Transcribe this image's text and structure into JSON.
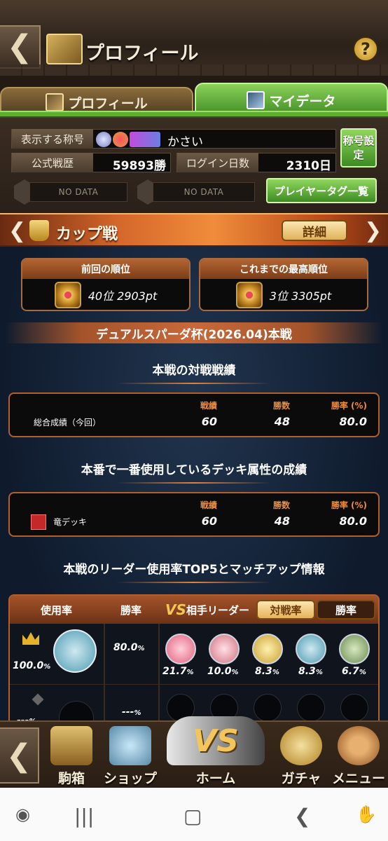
{
  "header": {
    "title": "プロフィール"
  },
  "tabs": [
    {
      "label": "プロフィール",
      "active": false
    },
    {
      "label": "マイデータ",
      "active": true
    }
  ],
  "profile": {
    "title_label": "表示する称号",
    "title_value": "かさい",
    "title_settings_button": "称号設定",
    "official_record_label": "公式戦歴",
    "official_record_value": "59893勝",
    "login_days_label": "ログイン日数",
    "login_days_value": "2310日",
    "no_data_1": "NO DATA",
    "no_data_2": "NO DATA",
    "player_tag_button": "プレイヤータグ一覧"
  },
  "cup": {
    "title": "カップ戦",
    "detail_button": "詳細",
    "previous_rank_label": "前回の順位",
    "previous_rank_value": "40位 2903pt",
    "best_rank_label": "これまでの最高順位",
    "best_rank_value": "3位 3305pt",
    "cup_name": "デュアルスパーダ杯(2026.04)本戦"
  },
  "battle_record": {
    "section_title": "本戦の対戦戦績",
    "col_record": "戦績",
    "col_wins": "勝数",
    "col_winrate": "勝率 (%)",
    "row_label": "総合成績（今回）",
    "record": "60",
    "wins": "48",
    "winrate": "80.0"
  },
  "deck_record": {
    "section_title": "本番で一番使用しているデッキ属性の成績",
    "col_record": "戦績",
    "col_wins": "勝数",
    "col_winrate": "勝率 (%)",
    "row_label": "竜デッキ",
    "record": "60",
    "wins": "48",
    "winrate": "80.0"
  },
  "top5": {
    "section_title": "本戦のリーダー使用率TOP5とマッチアップ情報",
    "col_usage": "使用率",
    "col_winrate": "勝率",
    "vs": "VS",
    "col_opponent": "相手リーダー",
    "toggle_matchup": "対戦率",
    "toggle_winrate": "勝率",
    "row1_usage": "100.0",
    "row1_winrate": "80.0",
    "opponents": [
      "21.7",
      "10.0",
      "8.3",
      "8.3",
      "6.7"
    ],
    "unit": "%",
    "row2_usage": "---",
    "row2_winrate": "---"
  },
  "bottom_nav": {
    "items": [
      "駒箱",
      "ショップ",
      "ホーム",
      "ガチャ",
      "メニュー"
    ]
  },
  "colors": {
    "accent_orange": "#f08c3a",
    "green_button": "#5fae2f"
  }
}
